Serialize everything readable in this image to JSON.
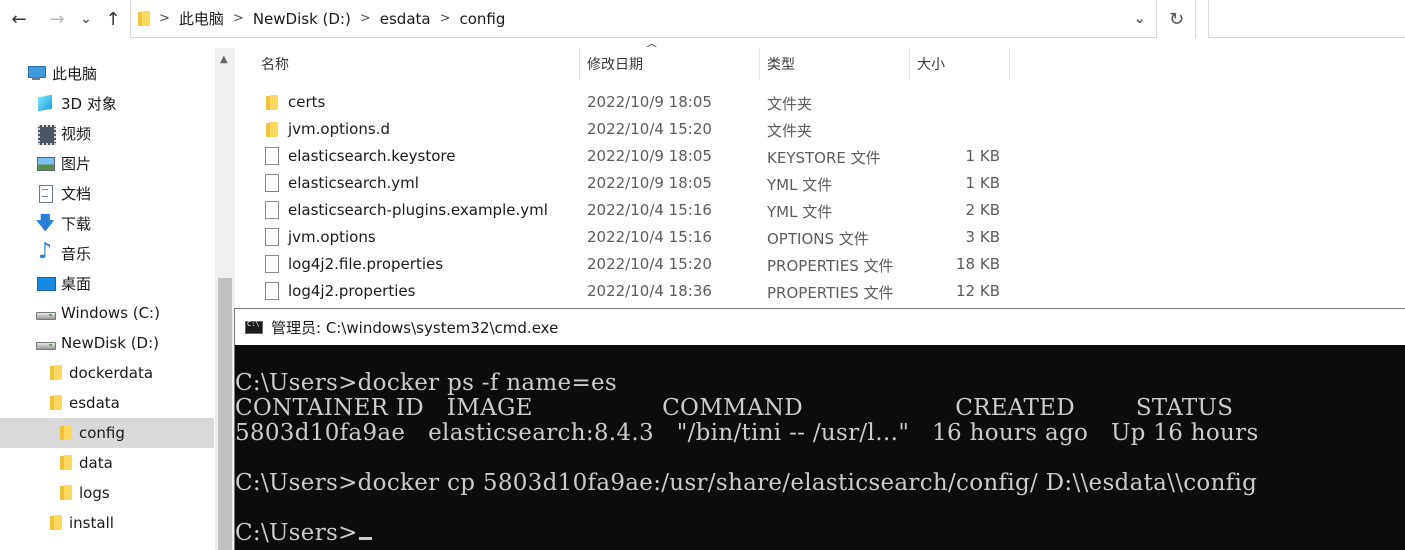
{
  "nav": {
    "back": "←",
    "forward": "→",
    "recent": "⌄",
    "up": "↑"
  },
  "breadcrumb": [
    "此电脑",
    "NewDisk (D:)",
    "esdata",
    "config"
  ],
  "sidebar": {
    "items": [
      {
        "label": "此电脑",
        "icon": "pc-icon"
      },
      {
        "label": "3D 对象",
        "icon": "3d-objects-icon"
      },
      {
        "label": "视频",
        "icon": "video-icon"
      },
      {
        "label": "图片",
        "icon": "pictures-icon"
      },
      {
        "label": "文档",
        "icon": "documents-icon"
      },
      {
        "label": "下载",
        "icon": "downloads-icon"
      },
      {
        "label": "音乐",
        "icon": "music-icon"
      },
      {
        "label": "桌面",
        "icon": "desktop-icon"
      },
      {
        "label": "Windows (C:)",
        "icon": "drive-icon"
      },
      {
        "label": "NewDisk (D:)",
        "icon": "drive-icon"
      },
      {
        "label": "dockerdata",
        "icon": "folder-icon"
      },
      {
        "label": "esdata",
        "icon": "folder-icon"
      },
      {
        "label": "config",
        "icon": "folder-icon",
        "selected": true
      },
      {
        "label": "data",
        "icon": "folder-icon"
      },
      {
        "label": "logs",
        "icon": "folder-icon"
      },
      {
        "label": "install",
        "icon": "folder-icon"
      }
    ]
  },
  "columns": {
    "name": "名称",
    "date": "修改日期",
    "type": "类型",
    "size": "大小"
  },
  "files": [
    {
      "name": "certs",
      "date": "2022/10/9 18:05",
      "type": "文件夹",
      "size": "",
      "icon": "folder-icon"
    },
    {
      "name": "jvm.options.d",
      "date": "2022/10/4 15:20",
      "type": "文件夹",
      "size": "",
      "icon": "folder-icon"
    },
    {
      "name": "elasticsearch.keystore",
      "date": "2022/10/9 18:05",
      "type": "KEYSTORE 文件",
      "size": "1 KB",
      "icon": "file-icon"
    },
    {
      "name": "elasticsearch.yml",
      "date": "2022/10/9 18:05",
      "type": "YML 文件",
      "size": "1 KB",
      "icon": "file-icon"
    },
    {
      "name": "elasticsearch-plugins.example.yml",
      "date": "2022/10/4 15:16",
      "type": "YML 文件",
      "size": "2 KB",
      "icon": "file-icon"
    },
    {
      "name": "jvm.options",
      "date": "2022/10/4 15:16",
      "type": "OPTIONS 文件",
      "size": "3 KB",
      "icon": "file-icon"
    },
    {
      "name": "log4j2.file.properties",
      "date": "2022/10/4 15:20",
      "type": "PROPERTIES 文件",
      "size": "18 KB",
      "icon": "file-icon"
    },
    {
      "name": "log4j2.properties",
      "date": "2022/10/4 18:36",
      "type": "PROPERTIES 文件",
      "size": "12 KB",
      "icon": "file-icon"
    }
  ],
  "cmd": {
    "title": "管理员: C:\\windows\\system32\\cmd.exe",
    "lines": [
      "C:\\Users>docker ps -f name=es",
      "CONTAINER ID   IMAGE                 COMMAND                    CREATED        STATUS",
      "5803d10fa9ae   elasticsearch:8.4.3   \"/bin/tini -- /usr/l…\"   16 hours ago   Up 16 hours",
      "",
      "C:\\Users>docker cp 5803d10fa9ae:/usr/share/elasticsearch/config/ D:\\\\esdata\\\\config",
      "",
      "C:\\Users>"
    ]
  }
}
